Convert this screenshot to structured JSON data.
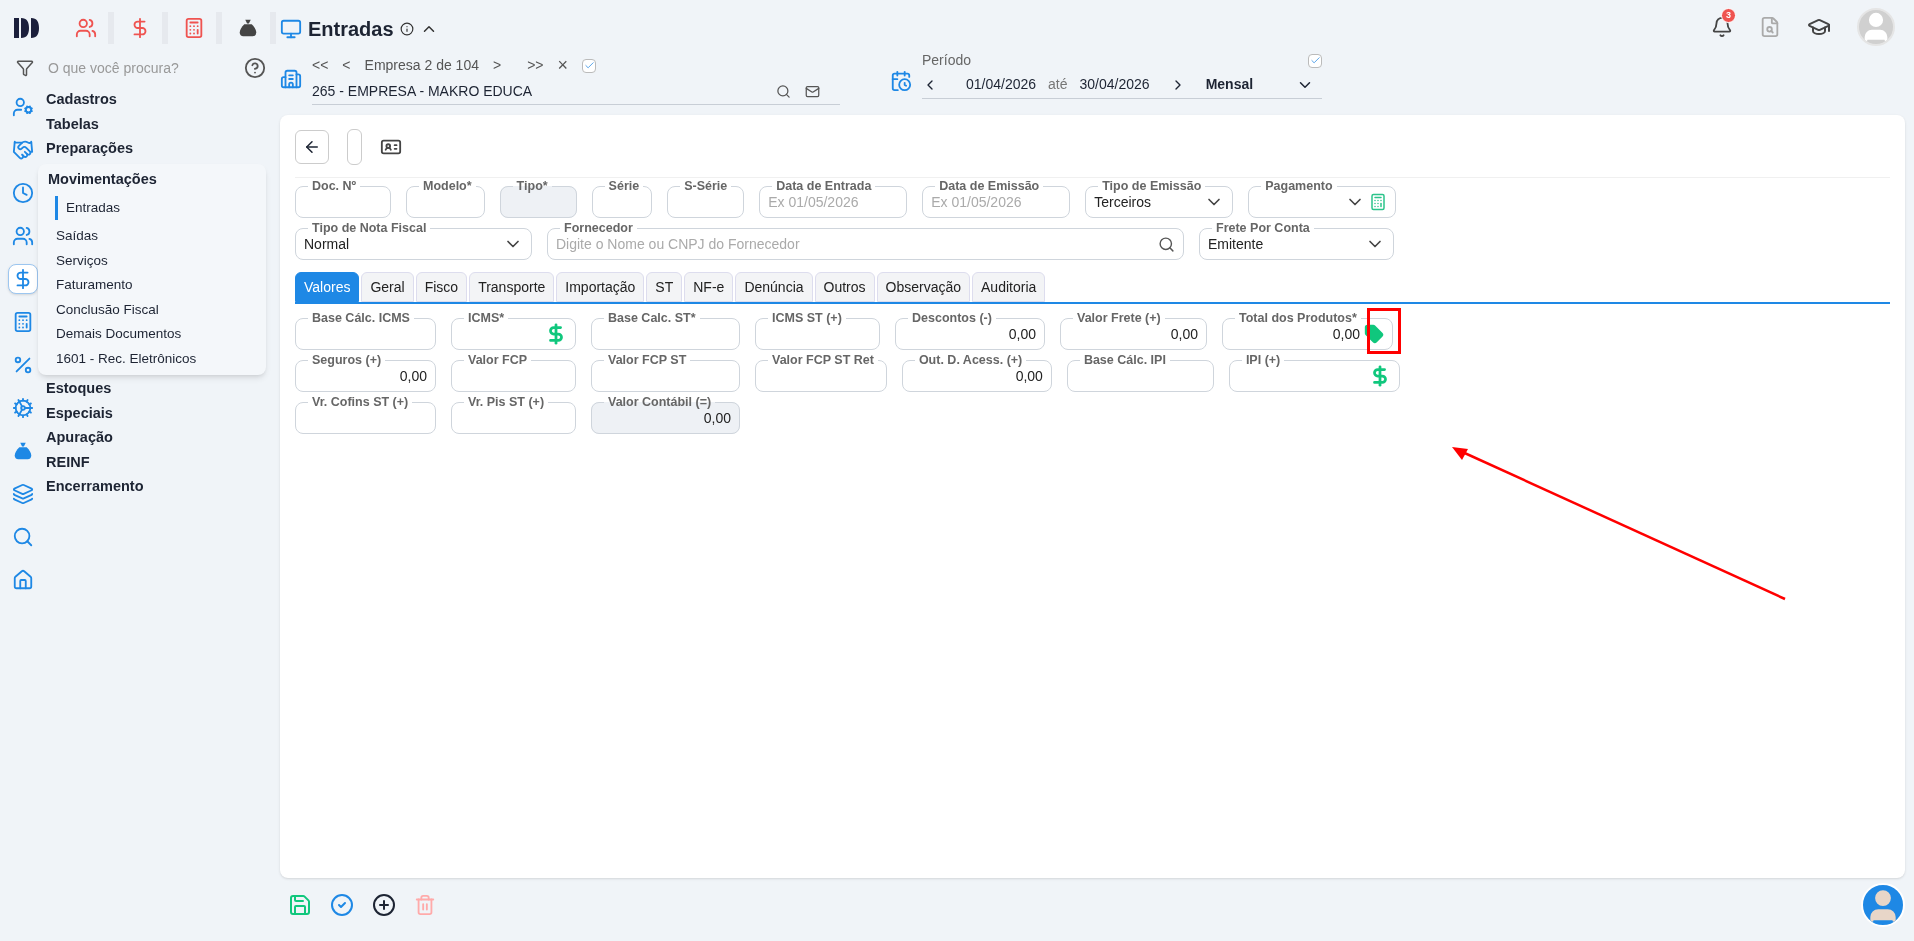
{
  "search": {
    "placeholder": "O que você procura?"
  },
  "rail": [
    {
      "selected": false
    },
    {
      "selected": false
    },
    {
      "selected": false
    },
    {
      "selected": false
    },
    {
      "selected": true
    },
    {
      "selected": false
    },
    {
      "selected": false
    },
    {
      "selected": false
    },
    {
      "selected": false
    },
    {
      "selected": false
    },
    {
      "selected": false
    },
    {
      "selected": false
    }
  ],
  "menu": [
    {
      "label": "Cadastros",
      "expanded": false
    },
    {
      "label": "Tabelas",
      "expanded": false
    },
    {
      "label": "Preparações",
      "expanded": false
    },
    {
      "label": "Movimentações",
      "expanded": true,
      "children": [
        {
          "label": "Entradas",
          "selected": true
        },
        {
          "label": "Saídas",
          "selected": false
        },
        {
          "label": "Serviços",
          "selected": false
        },
        {
          "label": "Faturamento",
          "selected": false
        },
        {
          "label": "Conclusão Fiscal",
          "selected": false
        },
        {
          "label": "Demais Documentos",
          "selected": false
        },
        {
          "label": "1601 - Rec. Eletrônicos",
          "selected": false
        }
      ]
    },
    {
      "label": "Estoques",
      "expanded": false
    },
    {
      "label": "Especiais",
      "expanded": false
    },
    {
      "label": "Apuração",
      "expanded": false
    },
    {
      "label": "REINF",
      "expanded": false
    },
    {
      "label": "Encerramento",
      "expanded": false
    }
  ],
  "page": {
    "title": "Entradas"
  },
  "company": {
    "nav_first": "<<",
    "nav_prev": "<",
    "position": "Empresa 2 de 104",
    "nav_next": ">",
    "nav_last": ">>",
    "clear": "×",
    "checked": true,
    "value": "265 - EMPRESA - MAKRO EDUCA"
  },
  "period": {
    "label": "Período",
    "checked": true,
    "start": "01/04/2026",
    "separator": "até",
    "end": "30/04/2026",
    "mode": "Mensal"
  },
  "notifications": {
    "count": "3"
  },
  "header_fields": [
    [
      {
        "label": "Doc. Nº",
        "kind": "text",
        "disabled": false
      },
      {
        "label": "Modelo*",
        "kind": "text",
        "disabled": false
      },
      {
        "label": "Tipo*",
        "kind": "text",
        "disabled": true
      },
      {
        "label": "Série",
        "kind": "text",
        "disabled": false
      },
      {
        "label": "S-Série",
        "kind": "text",
        "disabled": false
      },
      {
        "label": "Data de Entrada",
        "kind": "text",
        "disabled": false,
        "placeholder": "Ex 01/05/2026"
      },
      {
        "label": "Data de Emissão",
        "kind": "text",
        "disabled": false,
        "placeholder": "Ex 01/05/2026"
      },
      {
        "label": "Tipo de Emissão",
        "kind": "select",
        "disabled": false,
        "value": "Terceiros"
      },
      {
        "label": "Pagamento",
        "kind": "select-calc",
        "disabled": false
      }
    ],
    [
      {
        "label": "Tipo de Nota Fiscal",
        "kind": "select",
        "disabled": false,
        "value": "Normal"
      },
      {
        "label": "Fornecedor",
        "kind": "search",
        "disabled": false,
        "placeholder": "Digite o Nome ou CNPJ do Fornecedor"
      },
      {
        "label": "Frete Por Conta",
        "kind": "select",
        "disabled": false,
        "value": "Emitente"
      }
    ]
  ],
  "tabs": [
    {
      "label": "Valores",
      "selected": true
    },
    {
      "label": "Geral",
      "selected": false
    },
    {
      "label": "Fisco",
      "selected": false
    },
    {
      "label": "Transporte",
      "selected": false
    },
    {
      "label": "Importação",
      "selected": false
    },
    {
      "label": "ST",
      "selected": false
    },
    {
      "label": "NF-e",
      "selected": false
    },
    {
      "label": "Denúncia",
      "selected": false
    },
    {
      "label": "Outros",
      "selected": false
    },
    {
      "label": "Observação",
      "selected": false
    },
    {
      "label": "Auditoria",
      "selected": false
    }
  ],
  "value_fields": [
    [
      {
        "label": "Base Cálc. ICMS",
        "kind": "text",
        "disabled": false
      },
      {
        "label": "ICMS*",
        "kind": "dollar",
        "disabled": false
      },
      {
        "label": "Base Calc. ST*",
        "kind": "text",
        "disabled": false
      },
      {
        "label": "ICMS ST (+)",
        "kind": "text",
        "disabled": false
      },
      {
        "label": "Descontos (-)",
        "kind": "text",
        "disabled": false,
        "value": "0,00"
      },
      {
        "label": "Valor Frete (+)",
        "kind": "text",
        "disabled": false,
        "value": "0,00"
      },
      {
        "label": "Total dos Produtos*",
        "kind": "tag",
        "disabled": false,
        "value": "0,00"
      }
    ],
    [
      {
        "label": "Seguros (+)",
        "kind": "text",
        "disabled": false,
        "value": "0,00"
      },
      {
        "label": "Valor FCP",
        "kind": "text",
        "disabled": false
      },
      {
        "label": "Valor FCP ST",
        "kind": "text",
        "disabled": false
      },
      {
        "label": "Valor FCP ST Ret",
        "kind": "text",
        "disabled": false
      },
      {
        "label": "Out. D. Acess. (+)",
        "kind": "text",
        "disabled": false,
        "value": "0,00"
      },
      {
        "label": "Base Cálc. IPI",
        "kind": "text",
        "disabled": false
      },
      {
        "label": "IPI (+)",
        "kind": "dollar",
        "disabled": false
      }
    ],
    [
      {
        "label": "Vr. Cofins ST (+)",
        "kind": "text",
        "disabled": false
      },
      {
        "label": "Vr. Pis ST (+)",
        "kind": "text",
        "disabled": false
      },
      {
        "label": "Valor Contábil (=)",
        "kind": "text",
        "disabled": true,
        "value": "0,00"
      }
    ]
  ]
}
